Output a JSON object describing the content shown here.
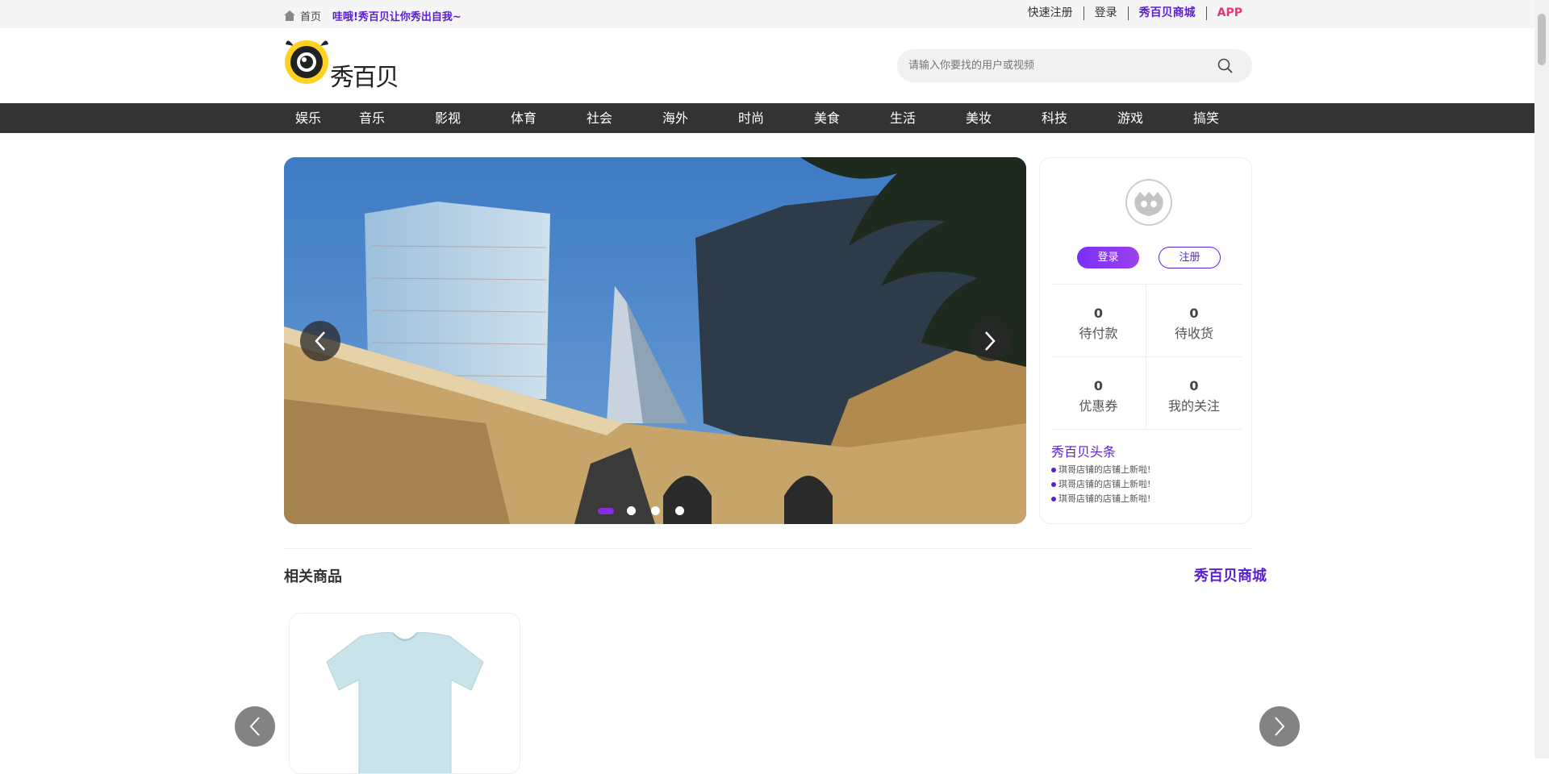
{
  "topbar": {
    "home_label": "首页",
    "slogan": "哇哦!秀百贝让你秀出自我~",
    "links": {
      "register": "快速注册",
      "login": "登录",
      "mall": "秀百贝商城",
      "app": "APP"
    }
  },
  "header": {
    "logo_text": "秀百贝",
    "search_placeholder": "请输入你要找的用户或视频"
  },
  "nav": {
    "items": [
      "娱乐",
      "音乐",
      "影视",
      "体育",
      "社会",
      "海外",
      "时尚",
      "美食",
      "生活",
      "美妆",
      "科技",
      "游戏",
      "搞笑"
    ]
  },
  "carousel": {
    "slide_count": 4,
    "active_index": 0
  },
  "user_panel": {
    "login_label": "登录",
    "register_label": "注册",
    "stats": [
      {
        "value": "0",
        "label": "待付款"
      },
      {
        "value": "0",
        "label": "待收货"
      },
      {
        "value": "0",
        "label": "优惠券"
      },
      {
        "value": "0",
        "label": "我的关注"
      }
    ],
    "news_title": "秀百贝头条",
    "news": [
      "琪哥店铺的店铺上新啦!",
      "琪哥店铺的店铺上新啦!",
      "琪哥店铺的店铺上新啦!"
    ]
  },
  "products_section": {
    "title": "相关商品",
    "link": "秀百贝商城"
  },
  "colors": {
    "accent_purple": "#5a1fd1",
    "app_pink": "#e8346f",
    "nav_bg": "#333333"
  }
}
